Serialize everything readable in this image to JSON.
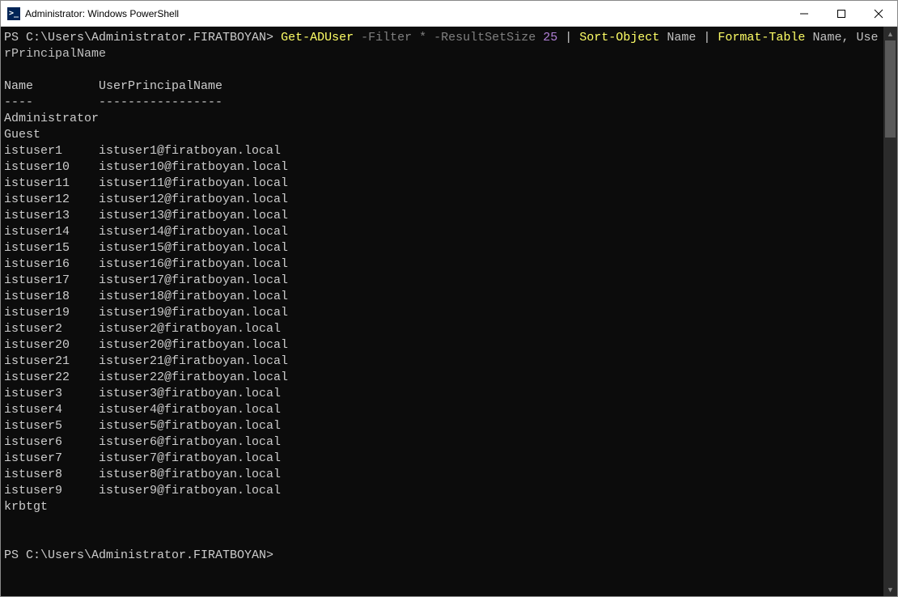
{
  "window": {
    "title": "Administrator: Windows PowerShell",
    "icon_glyph": ">_"
  },
  "prompt": {
    "path": "PS C:\\Users\\Administrator.FIRATBOYAN>"
  },
  "command": {
    "cmd1": "Get-ADUser",
    "p_filter": "-Filter",
    "star": "*",
    "p_rss": "-ResultSetSize",
    "rss_val": "25",
    "pipe": "|",
    "cmd2": "Sort-Object",
    "arg_name": "Name",
    "cmd3": "Format-Table",
    "ft_args_a": "Name,",
    "ft_args_b_line1": "Use",
    "ft_args_b_line2": "rPrincipalName"
  },
  "headers": {
    "name": "Name",
    "upn": "UserPrincipalName",
    "name_ul": "----",
    "upn_ul": "-----------------"
  },
  "rows": [
    {
      "name": "Administrator",
      "upn": ""
    },
    {
      "name": "Guest",
      "upn": ""
    },
    {
      "name": "istuser1",
      "upn": "istuser1@firatboyan.local"
    },
    {
      "name": "istuser10",
      "upn": "istuser10@firatboyan.local"
    },
    {
      "name": "istuser11",
      "upn": "istuser11@firatboyan.local"
    },
    {
      "name": "istuser12",
      "upn": "istuser12@firatboyan.local"
    },
    {
      "name": "istuser13",
      "upn": "istuser13@firatboyan.local"
    },
    {
      "name": "istuser14",
      "upn": "istuser14@firatboyan.local"
    },
    {
      "name": "istuser15",
      "upn": "istuser15@firatboyan.local"
    },
    {
      "name": "istuser16",
      "upn": "istuser16@firatboyan.local"
    },
    {
      "name": "istuser17",
      "upn": "istuser17@firatboyan.local"
    },
    {
      "name": "istuser18",
      "upn": "istuser18@firatboyan.local"
    },
    {
      "name": "istuser19",
      "upn": "istuser19@firatboyan.local"
    },
    {
      "name": "istuser2",
      "upn": "istuser2@firatboyan.local"
    },
    {
      "name": "istuser20",
      "upn": "istuser20@firatboyan.local"
    },
    {
      "name": "istuser21",
      "upn": "istuser21@firatboyan.local"
    },
    {
      "name": "istuser22",
      "upn": "istuser22@firatboyan.local"
    },
    {
      "name": "istuser3",
      "upn": "istuser3@firatboyan.local"
    },
    {
      "name": "istuser4",
      "upn": "istuser4@firatboyan.local"
    },
    {
      "name": "istuser5",
      "upn": "istuser5@firatboyan.local"
    },
    {
      "name": "istuser6",
      "upn": "istuser6@firatboyan.local"
    },
    {
      "name": "istuser7",
      "upn": "istuser7@firatboyan.local"
    },
    {
      "name": "istuser8",
      "upn": "istuser8@firatboyan.local"
    },
    {
      "name": "istuser9",
      "upn": "istuser9@firatboyan.local"
    },
    {
      "name": "krbtgt",
      "upn": ""
    }
  ]
}
